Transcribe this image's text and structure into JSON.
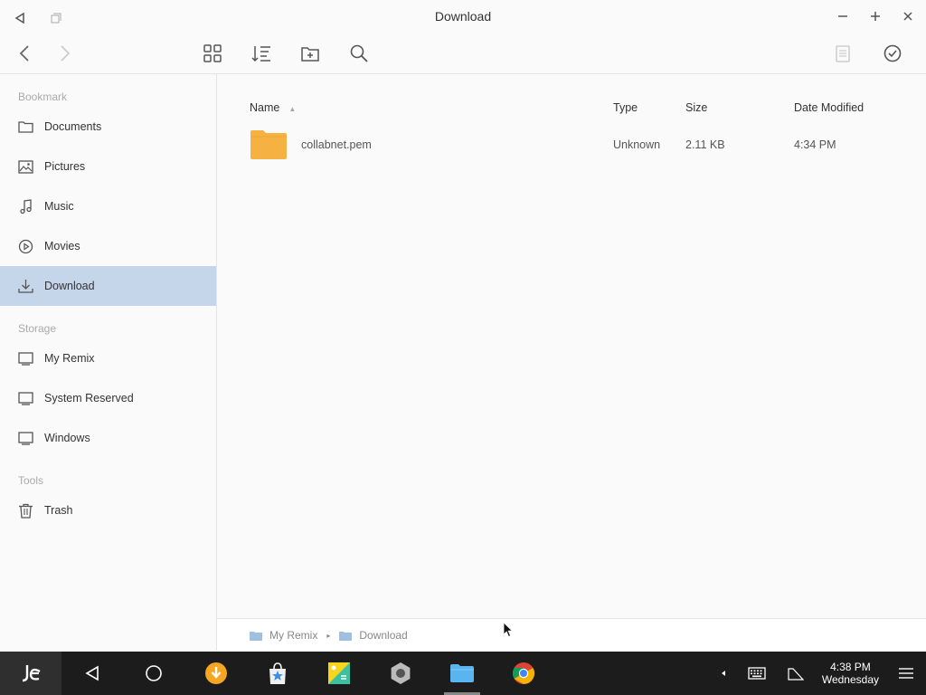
{
  "window": {
    "title": "Download"
  },
  "sidebar": {
    "bookmark_header": "Bookmark",
    "bookmarks": [
      {
        "label": "Documents",
        "icon": "folder-icon"
      },
      {
        "label": "Pictures",
        "icon": "image-icon"
      },
      {
        "label": "Music",
        "icon": "music-note-icon"
      },
      {
        "label": "Movies",
        "icon": "play-circle-icon"
      },
      {
        "label": "Download",
        "icon": "download-icon",
        "active": true
      }
    ],
    "storage_header": "Storage",
    "storage": [
      {
        "label": "My Remix",
        "icon": "monitor-icon"
      },
      {
        "label": "System Reserved",
        "icon": "monitor-icon"
      },
      {
        "label": "Windows",
        "icon": "monitor-icon"
      }
    ],
    "tools_header": "Tools",
    "tools": [
      {
        "label": "Trash",
        "icon": "trash-icon"
      }
    ]
  },
  "table": {
    "columns": {
      "name": "Name",
      "type": "Type",
      "size": "Size",
      "date": "Date Modified"
    },
    "rows": [
      {
        "name": "collabnet.pem",
        "type": "Unknown",
        "size": "2.11 KB",
        "date": "4:34 PM"
      }
    ]
  },
  "pathbar": {
    "segments": [
      "My Remix",
      "Download"
    ]
  },
  "taskbar": {
    "logo": "Jide",
    "clock_time": "4:38 PM",
    "clock_day": "Wednesday"
  },
  "colors": {
    "accent": "#c5d5ea",
    "folder": "#f5b142",
    "taskbar": "#1c1c1c"
  }
}
